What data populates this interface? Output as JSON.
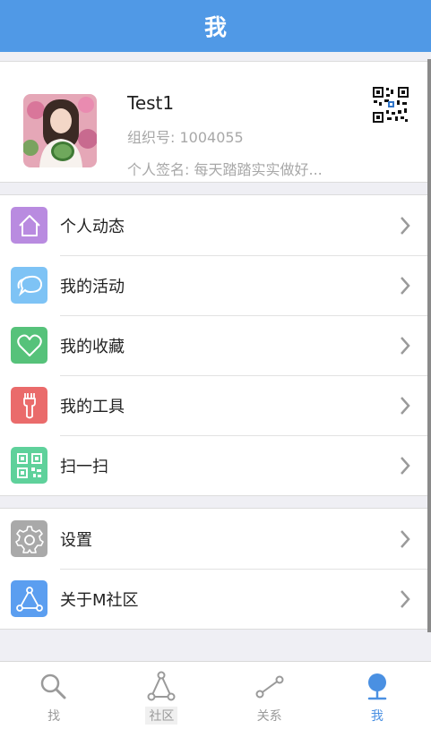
{
  "header": {
    "title": "我"
  },
  "profile": {
    "name": "Test1",
    "org_id": "组织号: 1004055",
    "signature": "个人签名: 每天踏踏实实做好..."
  },
  "menu": {
    "group1": [
      {
        "label": "个人动态",
        "icon": "house-icon",
        "color": "#b98be0"
      },
      {
        "label": "我的活动",
        "icon": "chat-bubbles-icon",
        "color": "#7ec3f5"
      },
      {
        "label": "我的收藏",
        "icon": "heart-icon",
        "color": "#56c27a"
      },
      {
        "label": "我的工具",
        "icon": "wrench-icon",
        "color": "#ea6b6b"
      },
      {
        "label": "扫一扫",
        "icon": "qr-scan-icon",
        "color": "#5fd19b"
      }
    ],
    "group2": [
      {
        "label": "设置",
        "icon": "gear-icon",
        "color": "#a9a9a9"
      },
      {
        "label": "关于M社区",
        "icon": "triangle-nodes-icon",
        "color": "#5b9ef0"
      }
    ]
  },
  "tabbar": {
    "tabs": [
      {
        "label": "找",
        "icon": "search-icon"
      },
      {
        "label": "社区",
        "icon": "community-icon"
      },
      {
        "label": "关系",
        "icon": "relation-icon"
      },
      {
        "label": "我",
        "icon": "me-icon",
        "active": true
      }
    ]
  },
  "colors": {
    "header": "#5099e6",
    "active_tab": "#4a90e2"
  }
}
